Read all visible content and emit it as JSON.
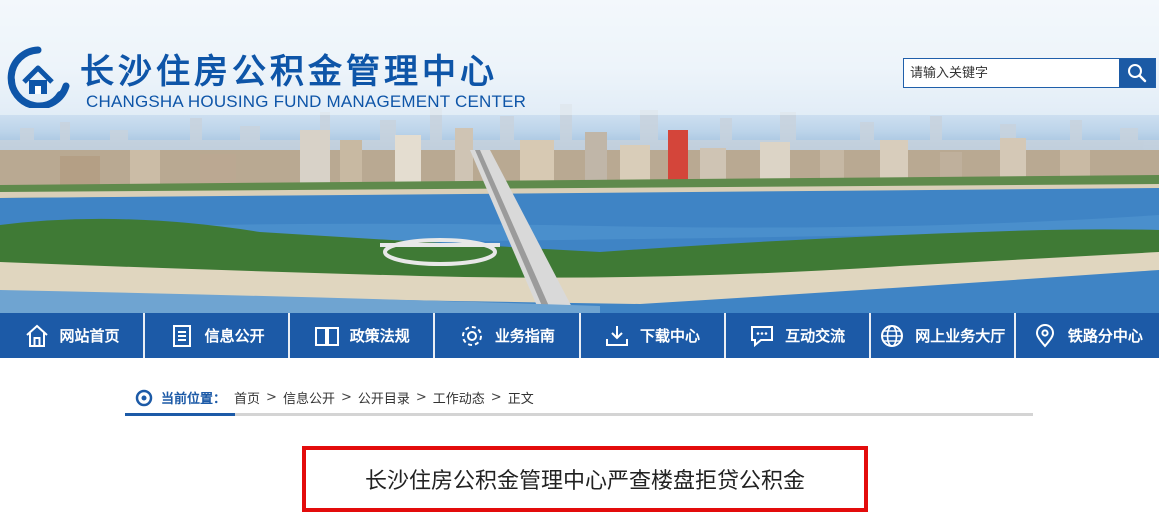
{
  "header": {
    "title_cn": "长沙住房公积金管理中心",
    "title_en": "CHANGSHA HOUSING FUND MANAGEMENT CENTER",
    "logo_icon": "house-fund-logo-icon"
  },
  "search": {
    "placeholder": "请输入关键字",
    "button_icon": "search-icon"
  },
  "nav": {
    "items": [
      {
        "label": "网站首页",
        "icon": "home-icon"
      },
      {
        "label": "信息公开",
        "icon": "document-list-icon"
      },
      {
        "label": "政策法规",
        "icon": "book-icon"
      },
      {
        "label": "业务指南",
        "icon": "gear-icon"
      },
      {
        "label": "下载中心",
        "icon": "download-icon"
      },
      {
        "label": "互动交流",
        "icon": "chat-icon"
      },
      {
        "label": "网上业务大厅",
        "icon": "globe-icon"
      },
      {
        "label": "铁路分中心",
        "icon": "location-pin-icon"
      }
    ]
  },
  "breadcrumb": {
    "label": "当前位置：",
    "separator": ">",
    "items": [
      "首页",
      "信息公开",
      "公开目录",
      "工作动态",
      "正文"
    ]
  },
  "article": {
    "title": "长沙住房公积金管理中心严查楼盘拒贷公积金"
  },
  "colors": {
    "brand_blue": "#1c5aa7",
    "title_blue": "#0e55a8",
    "highlight_red": "#e30c0c"
  }
}
